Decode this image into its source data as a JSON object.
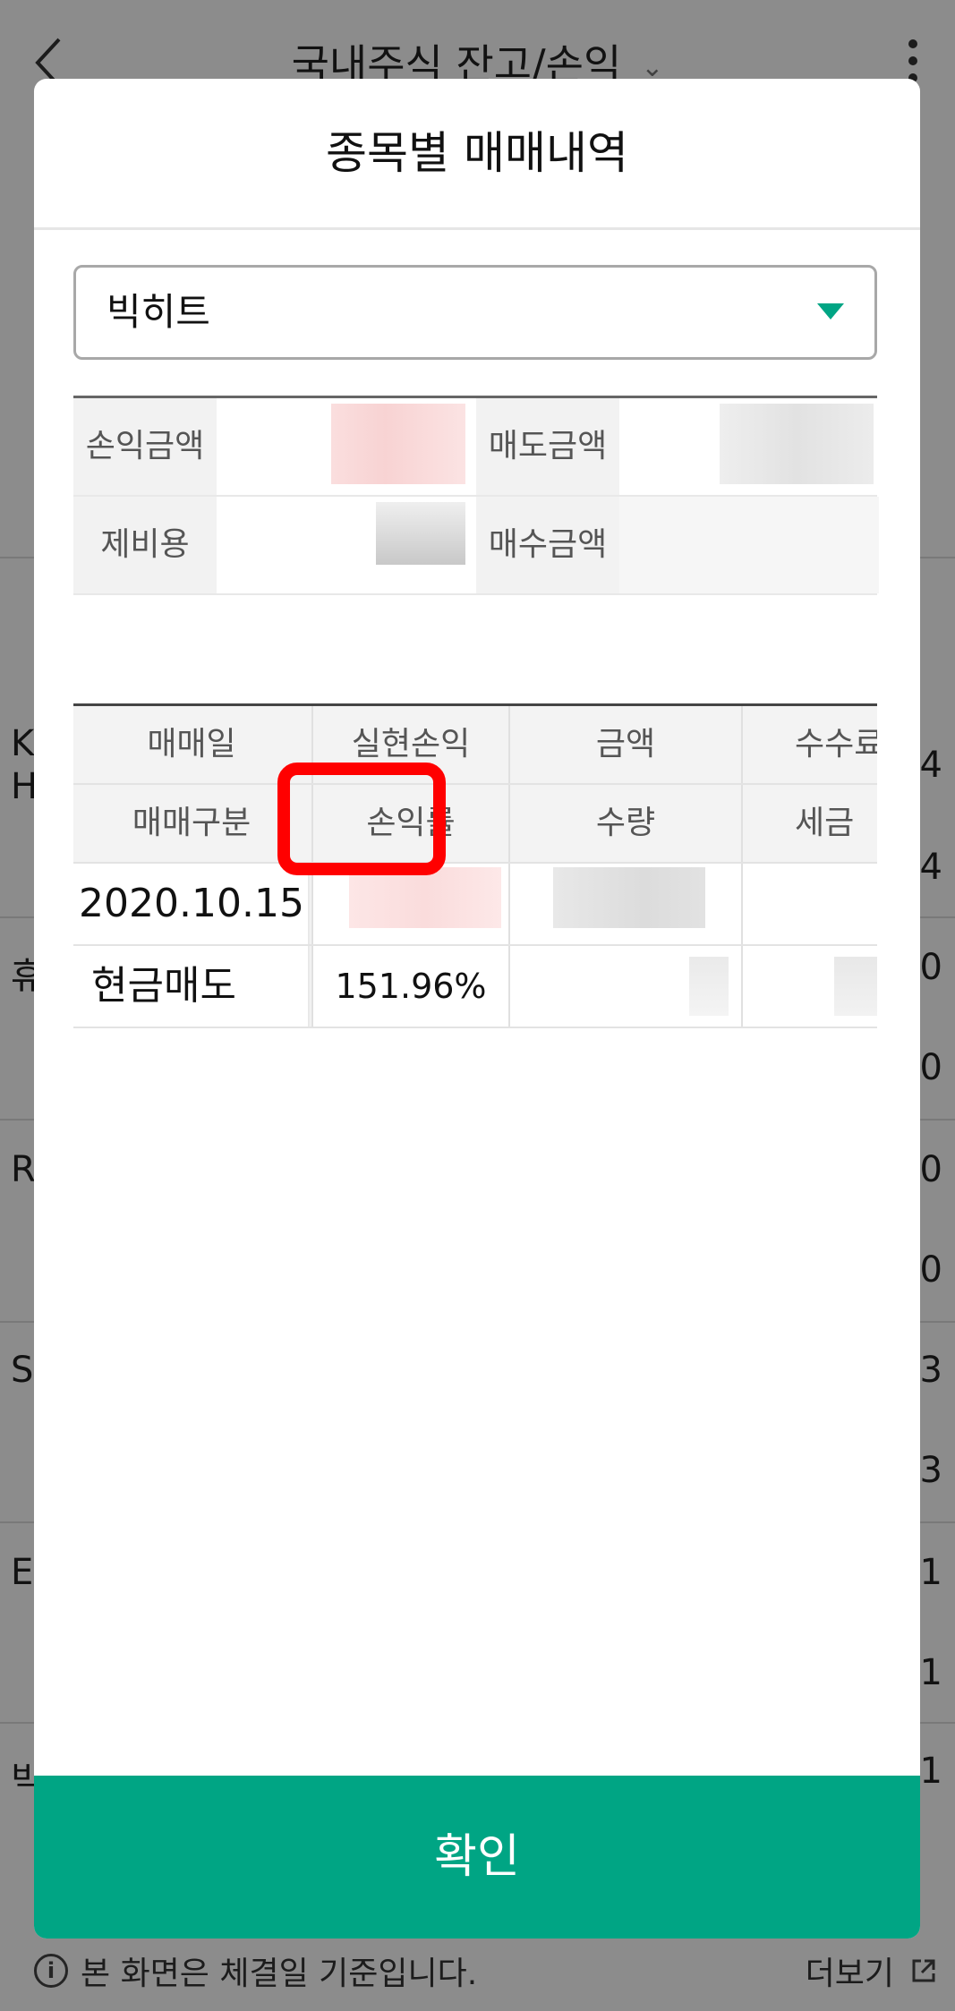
{
  "background": {
    "title": "국내주식 잔고/손익",
    "left_rows": [
      "K",
      "H",
      "휴",
      "R",
      "S",
      "E",
      "빅"
    ],
    "right_values": [
      "4",
      "4",
      "0",
      "0",
      "0",
      "0",
      "3",
      "3",
      "1",
      "1",
      "1"
    ],
    "footer_info": "본 화면은 체결일 기준입니다.",
    "footer_more": "더보기"
  },
  "modal": {
    "title": "종목별 매매내역",
    "stock_select": "빅히트",
    "summary": {
      "profit_label": "손익금액",
      "sell_label": "매도금액",
      "fee_label": "제비용",
      "buy_label": "매수금액"
    },
    "table": {
      "headers_row1": [
        "매매일",
        "실현손익",
        "금액",
        "수수료"
      ],
      "headers_row2": [
        "매매구분",
        "손익률",
        "수량",
        "세금"
      ],
      "rows": [
        {
          "date": "2020.10.15",
          "type": "현금매도",
          "return_rate": "151.96%"
        }
      ]
    },
    "confirm_label": "확인"
  },
  "colors": {
    "accent": "#00a584",
    "loss_profit_red": "#e0312f",
    "highlight": "#ff0000"
  }
}
